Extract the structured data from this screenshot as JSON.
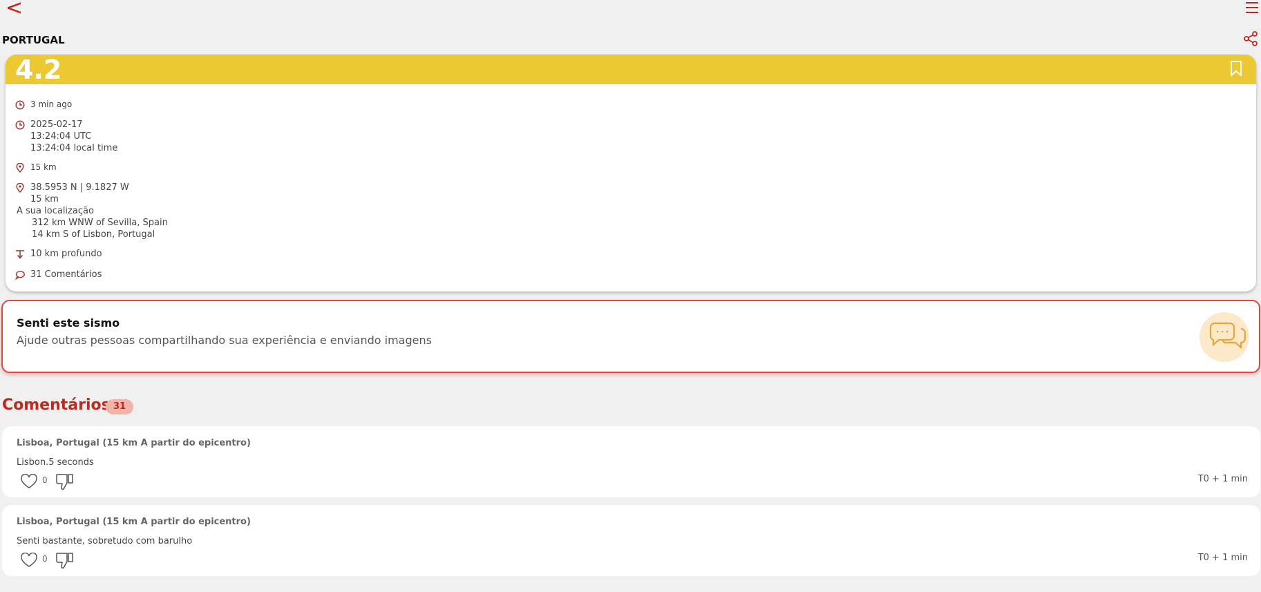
{
  "header": {
    "back_label": "<",
    "menu_icon": "hamburger-icon",
    "country": "PORTUGAL",
    "share_icon": "share-icon"
  },
  "event": {
    "magnitude": "4.2",
    "band_color": "#ecc833",
    "bookmark_icon": "bookmark-icon",
    "time_ago": "3 min ago",
    "date": "2025-02-17",
    "utc_time": "13:24:04 UTC",
    "local_time": "13:24:04 local time",
    "distance": "15 km",
    "coordinates": "38.5953 N | 9.1827 W",
    "coord_distance": "15 km",
    "your_location_label": "A sua localização",
    "location_line1": "312 km WNW of Sevilla, Spain",
    "location_line2": "14 km S of Lisbon, Portugal",
    "depth": "10 km profundo",
    "comments_count_label": "31 Comentários"
  },
  "felt": {
    "title": "Senti este sismo",
    "subtitle": "Ajude outras pessoas compartilhando sua experiência e enviando imagens",
    "icon": "chat-bubbles-icon"
  },
  "comments_section": {
    "heading": "Comentários",
    "count": "31"
  },
  "comments": [
    {
      "author": "Lisboa, Portugal (15 km A partir do epicentro)",
      "text": "Lisbon.5 seconds",
      "likes": "0",
      "time": "T0 + 1 min"
    },
    {
      "author": "Lisboa, Portugal (15 km A partir do epicentro)",
      "text": "Senti bastante, sobretudo com barulho",
      "likes": "0",
      "time": "T0 + 1 min"
    }
  ],
  "colors": {
    "accent": "#c0281e",
    "background": "#f0f0f0",
    "felt_border": "#e0483c"
  }
}
